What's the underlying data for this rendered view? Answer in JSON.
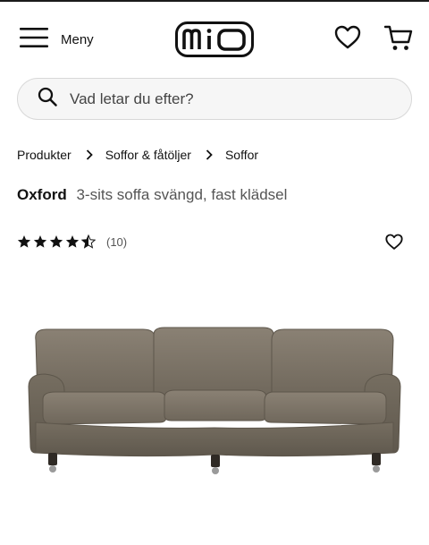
{
  "header": {
    "menu_label": "Meny",
    "logo_text": "mio",
    "icons": [
      "hamburger-menu-icon",
      "heart-icon",
      "cart-icon"
    ]
  },
  "search": {
    "placeholder": "Vad letar du efter?",
    "value": ""
  },
  "breadcrumb": [
    {
      "label": "Produkter"
    },
    {
      "label": "Soffor & fåtöljer"
    },
    {
      "label": "Soffor"
    }
  ],
  "product": {
    "brand": "Oxford",
    "description": "3-sits soffa svängd, fast klädsel",
    "rating": 4.5,
    "rating_max": 5,
    "review_count": "(10)",
    "image": "sofa"
  },
  "colors": {
    "sofa_fabric": "#7d7466",
    "text": "#111111",
    "muted": "#555555"
  }
}
